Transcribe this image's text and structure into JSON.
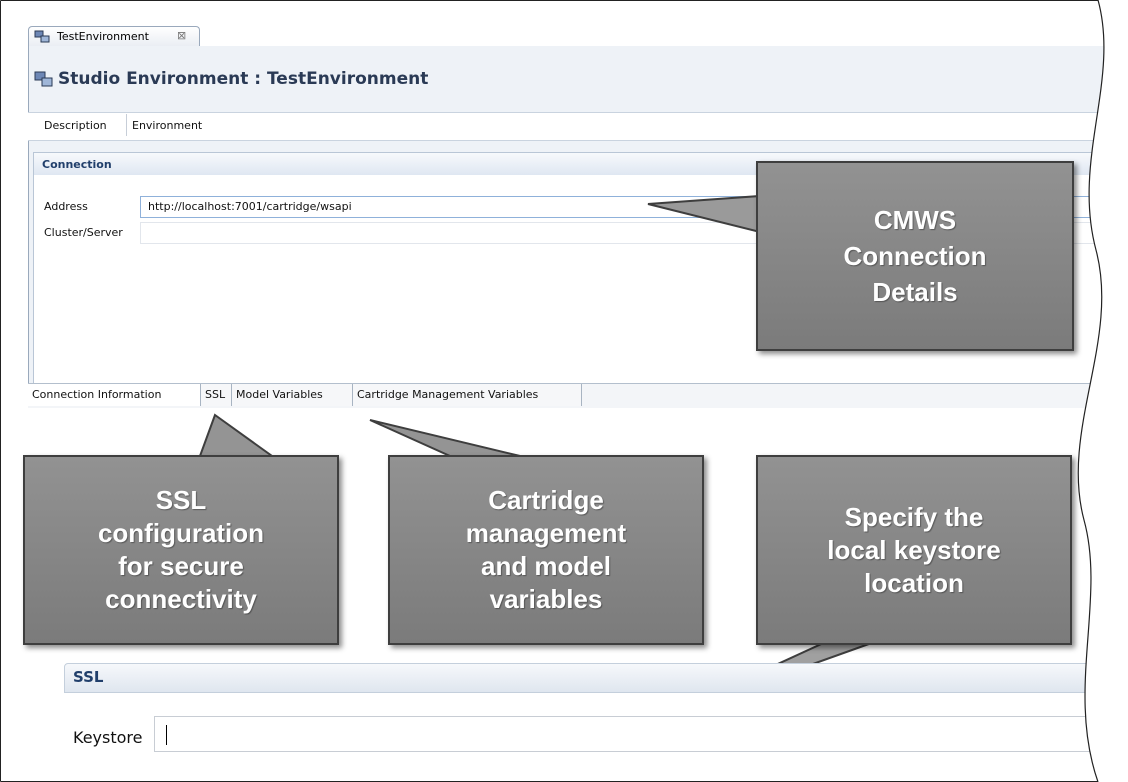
{
  "editor": {
    "tab_label": "TestEnvironment",
    "close_symbol": "⊠",
    "title": "Studio Environment : TestEnvironment",
    "description": {
      "label": "Description",
      "value": "Environment"
    },
    "connection": {
      "section_title": "Connection",
      "address_label": "Address",
      "address_value": "http://localhost:7001/cartridge/wsapi",
      "cluster_label": "Cluster/Server",
      "cluster_value": ""
    },
    "bottom_tabs": [
      "Connection Information",
      "SSL",
      "Model Variables",
      "Cartridge Management Variables"
    ]
  },
  "callouts": {
    "cmws": "CMWS\nConnection\nDetails",
    "ssl": "SSL\nconfiguration\nfor secure\nconnectivity",
    "cartridge": "Cartridge\nmanagement\nand model\nvariables",
    "keystore": "Specify the\nlocal keystore\nlocation"
  },
  "ssl_panel": {
    "section_title": "SSL",
    "keystore_label": "Keystore",
    "keystore_value": ""
  },
  "icons": [
    "environment-icon",
    "close-icon"
  ],
  "colors": {
    "callout_fill": "#858585",
    "section_title": "#213f6b",
    "address_border": "#8fb1da"
  }
}
